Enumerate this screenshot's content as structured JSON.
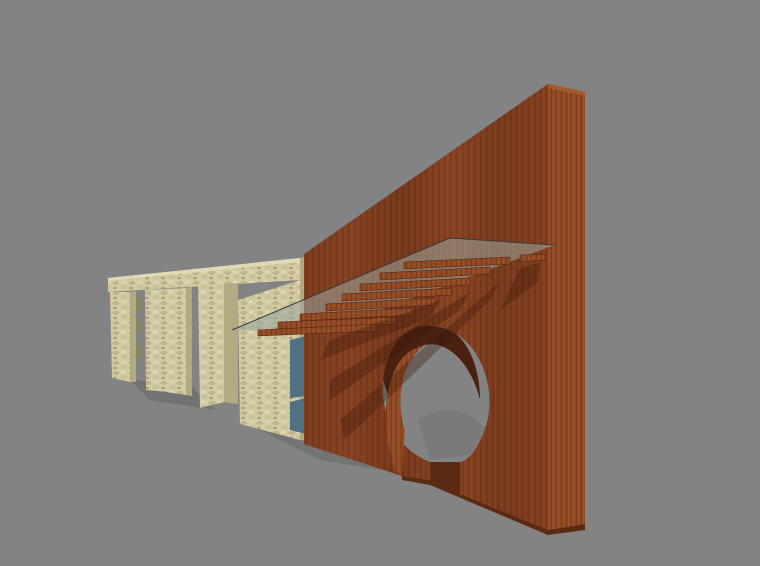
{
  "scene": {
    "background": "#838383",
    "colors": {
      "wood_front": "#7a3a1c",
      "wood_side": "#8e4a22",
      "wood_dark": "#5c2a14",
      "stone": "#cfc7a0",
      "stone_shade": "#b5ad86",
      "glass": "#4a6d7d",
      "shadow": "#6c6c6c",
      "glass_canopy": "#9aa6a0"
    }
  }
}
